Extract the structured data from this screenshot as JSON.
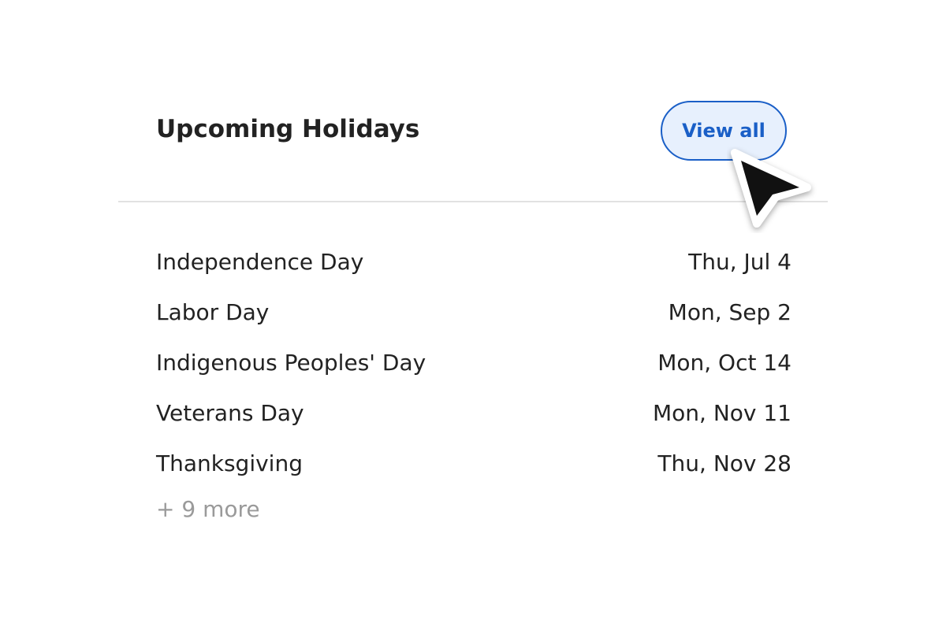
{
  "header": {
    "title": "Upcoming Holidays",
    "view_all_label": "View all"
  },
  "holidays": [
    {
      "name": "Independence Day",
      "date": "Thu, Jul 4"
    },
    {
      "name": "Labor Day",
      "date": "Mon, Sep 2"
    },
    {
      "name": "Indigenous Peoples' Day",
      "date": "Mon, Oct 14"
    },
    {
      "name": "Veterans Day",
      "date": "Mon, Nov 11"
    },
    {
      "name": "Thanksgiving",
      "date": "Thu, Nov 28"
    }
  ],
  "more_label": "+ 9 more",
  "colors": {
    "accent": "#1a5fc7",
    "button_bg": "#e7f0fd",
    "text": "#222222",
    "muted": "#9a9a9a",
    "divider": "#e2e2e2"
  },
  "icons": {
    "cursor": "mouse-pointer-icon"
  }
}
